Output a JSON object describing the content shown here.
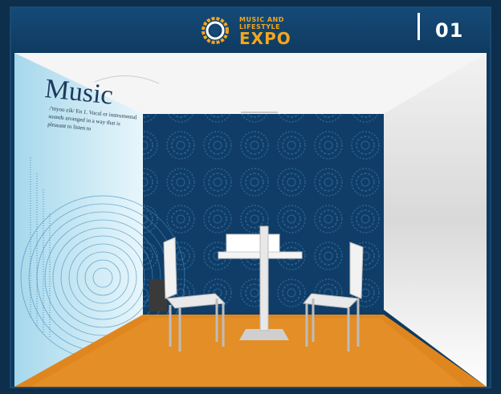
{
  "header": {
    "logo_line1": "MUSIC AND",
    "logo_line2": "LIFESTYLE",
    "logo_line3": "EXPO",
    "booth_number": "01"
  },
  "wall_graphic": {
    "title": "Music",
    "title_suffix": "/'myoo zik/",
    "subtitle": "En 1. Vocal or instrumental sounds arranged in a way that is pleasant to listen to"
  },
  "colors": {
    "brand_orange": "#f3a61c",
    "header_blue": "#154a77",
    "back_wall": "#0f3d68",
    "floor": "#e0861f"
  }
}
